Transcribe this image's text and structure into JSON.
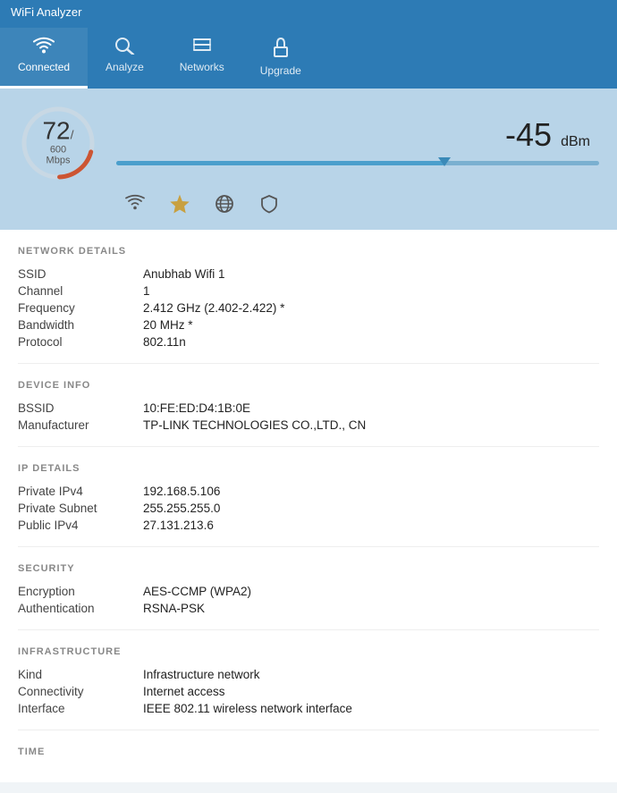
{
  "app": {
    "title": "WiFi Analyzer"
  },
  "nav": {
    "items": [
      {
        "id": "connected",
        "label": "Connected",
        "icon": "📶",
        "active": true
      },
      {
        "id": "analyze",
        "label": "Analyze",
        "icon": "🔍",
        "active": false
      },
      {
        "id": "networks",
        "label": "Networks",
        "icon": "☰",
        "active": false
      },
      {
        "id": "upgrade",
        "label": "Upgrade",
        "icon": "🎁",
        "active": false
      }
    ]
  },
  "header": {
    "gauge": {
      "value": "72",
      "slash": "/",
      "speed": "600 Mbps"
    },
    "signal": {
      "value": "-45",
      "unit": "dBm"
    },
    "signal_percent": 68
  },
  "network_details": {
    "section_label": "NETWORK DETAILS",
    "rows": [
      {
        "label": "SSID",
        "value": "Anubhab Wifi 1"
      },
      {
        "label": "Channel",
        "value": "1"
      },
      {
        "label": "Frequency",
        "value": "2.412 GHz  (2.402-2.422) *"
      },
      {
        "label": "Bandwidth",
        "value": "20 MHz *"
      },
      {
        "label": "Protocol",
        "value": "802.11n"
      }
    ]
  },
  "device_info": {
    "section_label": "DEVICE INFO",
    "rows": [
      {
        "label": "BSSID",
        "value": "10:FE:ED:D4:1B:0E"
      },
      {
        "label": "Manufacturer",
        "value": "TP-LINK TECHNOLOGIES CO.,LTD., CN"
      }
    ]
  },
  "ip_details": {
    "section_label": "IP DETAILS",
    "rows": [
      {
        "label": "Private IPv4",
        "value": "192.168.5.106"
      },
      {
        "label": "Private Subnet",
        "value": "255.255.255.0"
      },
      {
        "label": "Public IPv4",
        "value": "27.131.213.6"
      }
    ]
  },
  "security": {
    "section_label": "SECURITY",
    "rows": [
      {
        "label": "Encryption",
        "value": "AES-CCMP (WPA2)"
      },
      {
        "label": "Authentication",
        "value": "RSNA-PSK"
      }
    ]
  },
  "infrastructure": {
    "section_label": "INFRASTRUCTURE",
    "rows": [
      {
        "label": "Kind",
        "value": "Infrastructure network"
      },
      {
        "label": "Connectivity",
        "value": "Internet access"
      },
      {
        "label": "Interface",
        "value": "IEEE 802.11 wireless network interface"
      }
    ]
  },
  "time": {
    "section_label": "TIME"
  },
  "colors": {
    "nav_bg": "#2d7bb5",
    "header_bg": "#b8d4e8",
    "gauge_arc": "#cc5533",
    "gauge_track": "#dde"
  }
}
